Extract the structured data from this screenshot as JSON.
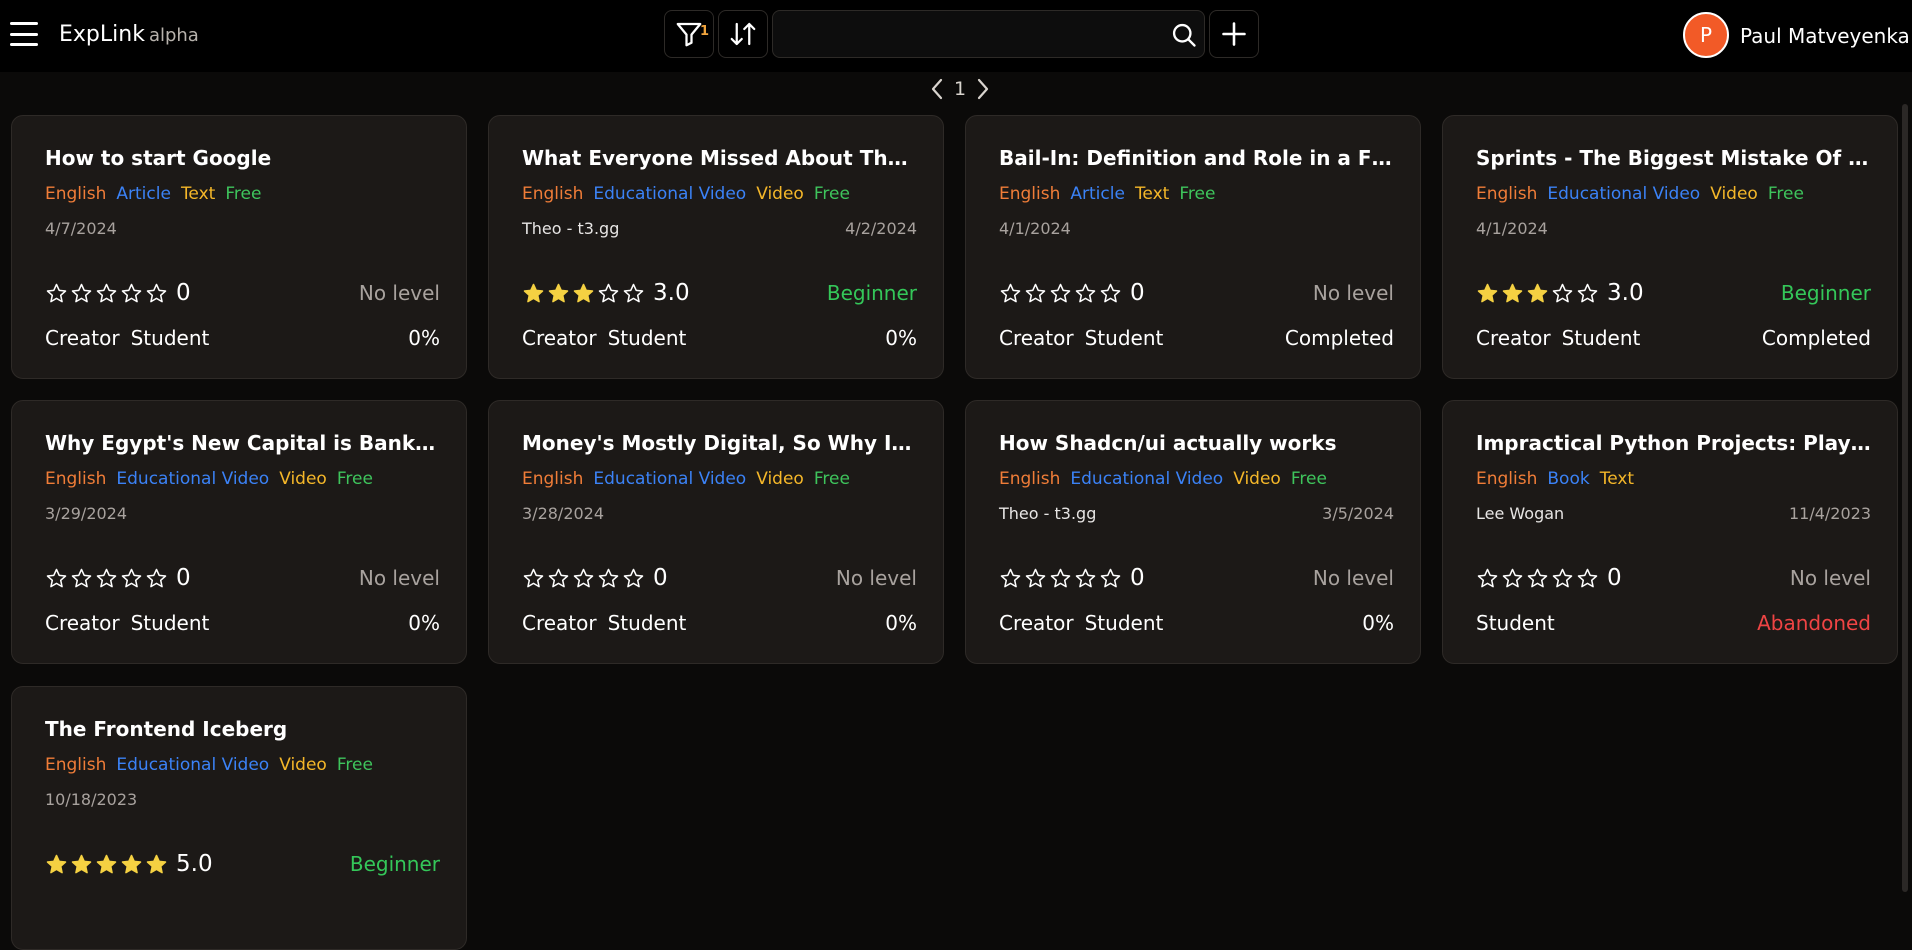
{
  "header": {
    "brand": "ExpLink",
    "brand_tag": "alpha",
    "filter_count": "1",
    "search_placeholder": "",
    "user_initial": "P",
    "user_name": "Paul Matveyenka"
  },
  "pagination": {
    "current_page": "1"
  },
  "colors": {
    "language": "#f07d38",
    "type": "#3b82f6",
    "medium": "#f5b729",
    "price": "#3ec45c",
    "star_filled": "#f5d142",
    "level_beginner": "#34c759",
    "status_abandoned": "#ef4444",
    "avatar": "#f25a27"
  },
  "cards": [
    {
      "title": "How to start Google",
      "language": "English",
      "type": "Article",
      "medium": "Text",
      "price": "Free",
      "author": "",
      "date": "4/7/2024",
      "stars": 0,
      "rating": "0",
      "level": "No level",
      "roles": [
        "Creator",
        "Student"
      ],
      "status": "0%"
    },
    {
      "title": "What Everyone Missed About The Linux...",
      "language": "English",
      "type": "Educational Video",
      "medium": "Video",
      "price": "Free",
      "author": "Theo - t3.gg",
      "date": "4/2/2024",
      "stars": 3,
      "rating": "3.0",
      "level": "Beginner",
      "roles": [
        "Creator",
        "Student"
      ],
      "status": "0%"
    },
    {
      "title": "Bail-In: Definition and Role in a Financia...",
      "language": "English",
      "type": "Article",
      "medium": "Text",
      "price": "Free",
      "author": "",
      "date": "4/1/2024",
      "stars": 0,
      "rating": "0",
      "level": "No level",
      "roles": [
        "Creator",
        "Student"
      ],
      "status": "Completed"
    },
    {
      "title": "Sprints - The Biggest Mistake Of Softwa...",
      "language": "English",
      "type": "Educational Video",
      "medium": "Video",
      "price": "Free",
      "author": "",
      "date": "4/1/2024",
      "stars": 3,
      "rating": "3.0",
      "level": "Beginner",
      "roles": [
        "Creator",
        "Student"
      ],
      "status": "Completed"
    },
    {
      "title": "Why Egypt's New Capital is Bankruptin...",
      "language": "English",
      "type": "Educational Video",
      "medium": "Video",
      "price": "Free",
      "author": "",
      "date": "3/29/2024",
      "stars": 0,
      "rating": "0",
      "level": "No level",
      "roles": [
        "Creator",
        "Student"
      ],
      "status": "0%"
    },
    {
      "title": "Money's Mostly Digital, So Why Is...",
      "language": "English",
      "type": "Educational Video",
      "medium": "Video",
      "price": "Free",
      "author": "",
      "date": "3/28/2024",
      "stars": 0,
      "rating": "0",
      "level": "No level",
      "roles": [
        "Creator",
        "Student"
      ],
      "status": "0%"
    },
    {
      "title": "How Shadcn/ui actually works",
      "language": "English",
      "type": "Educational Video",
      "medium": "Video",
      "price": "Free",
      "author": "Theo - t3.gg",
      "date": "3/5/2024",
      "stars": 0,
      "rating": "0",
      "level": "No level",
      "roles": [
        "Creator",
        "Student"
      ],
      "status": "0%"
    },
    {
      "title": "Impractical Python Projects: Playful...",
      "language": "English",
      "type": "Book",
      "medium": "Text",
      "price": "",
      "author": "Lee Wogan",
      "date": "11/4/2023",
      "stars": 0,
      "rating": "0",
      "level": "No level",
      "roles": [
        "Student"
      ],
      "status": "Abandoned"
    },
    {
      "title": "The Frontend Iceberg",
      "language": "English",
      "type": "Educational Video",
      "medium": "Video",
      "price": "Free",
      "author": "",
      "date": "10/18/2023",
      "stars": 5,
      "rating": "5.0",
      "level": "Beginner",
      "roles": [],
      "status": ""
    }
  ]
}
